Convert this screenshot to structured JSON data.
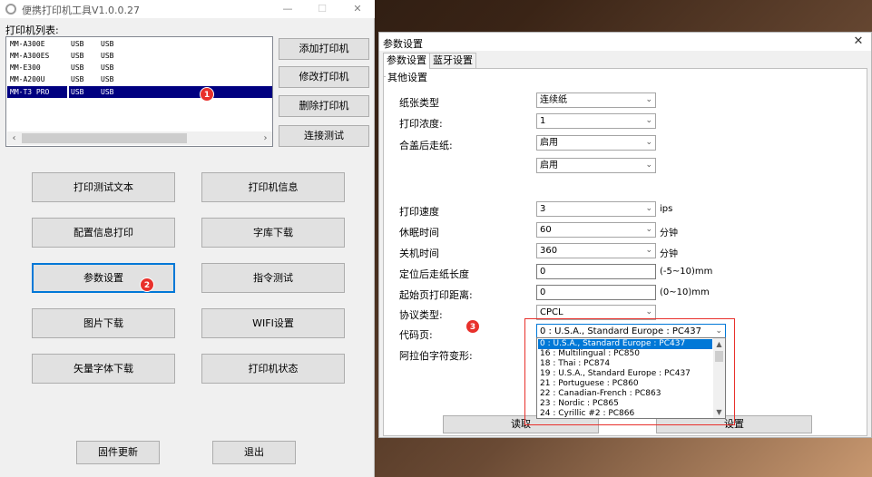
{
  "main_window": {
    "title": "便携打印机工具V1.0.0.27",
    "controls": {
      "minimize": "—",
      "maximize": "☐",
      "close": "✕"
    },
    "printer_list_label": "打印机列表:",
    "printers": [
      {
        "name": "MM-A300E",
        "interface1": "USB",
        "interface2": "USB"
      },
      {
        "name": "MM-A300ES",
        "interface1": "USB",
        "interface2": "USB"
      },
      {
        "name": "MM-E300",
        "interface1": "USB",
        "interface2": "USB"
      },
      {
        "name": "MM-A200U",
        "interface1": "USB",
        "interface2": "USB"
      },
      {
        "name": "MM-T3 PRO",
        "interface1": "USB",
        "interface2": "USB"
      }
    ],
    "side_buttons": [
      "添加打印机",
      "修改打印机",
      "删除打印机",
      "连接测试"
    ],
    "function_buttons": [
      "打印测试文本",
      "打印机信息",
      "配置信息打印",
      "字库下载",
      "参数设置",
      "指令测试",
      "图片下载",
      "WIFI设置",
      "矢量字体下载",
      "打印机状态"
    ],
    "bottom_buttons": [
      "固件更新",
      "退出"
    ]
  },
  "markers": [
    "1",
    "2",
    "3"
  ],
  "dialog": {
    "title": "参数设置",
    "close": "✕",
    "tabs": [
      "参数设置",
      "蓝牙设置"
    ],
    "group_label": "其他设置",
    "fields": {
      "paper_type": {
        "label": "纸张类型",
        "value": "连续纸"
      },
      "density": {
        "label": "打印浓度:",
        "value": "1"
      },
      "cover_feed": {
        "label": "合盖后走纸:",
        "value": "启用"
      },
      "extra": {
        "value": "启用"
      },
      "speed": {
        "label": "打印速度",
        "value": "3",
        "unit": "ips"
      },
      "sleep": {
        "label": "休眠时间",
        "value": "60",
        "unit": "分钟"
      },
      "shutdown": {
        "label": "关机时间",
        "value": "360",
        "unit": "分钟"
      },
      "feed_len": {
        "label": "定位后走纸长度",
        "value": "0",
        "unit": "(-5~10)mm"
      },
      "start_dist": {
        "label": "起始页打印距离:",
        "value": "0",
        "unit": "(0~10)mm"
      },
      "protocol": {
        "label": "协议类型:",
        "value": "CPCL"
      },
      "codepage": {
        "label": "代码页:",
        "value": "0 : U.S.A., Standard Europe : PC437"
      },
      "arabic": {
        "label": "阿拉伯字符变形:"
      }
    },
    "codepage_options": [
      "0 : U.S.A., Standard Europe : PC437",
      "16 : Multilingual : PC850",
      "18 : Thai : PC874",
      "19 : U.S.A., Standard Europe : PC437",
      "21 : Portuguese : PC860",
      "22 : Canadian-French : PC863",
      "23 : Nordic : PC865",
      "24 : Cyrillic #2 : PC866"
    ],
    "buttons": {
      "read": "读取",
      "set": "设置"
    }
  }
}
